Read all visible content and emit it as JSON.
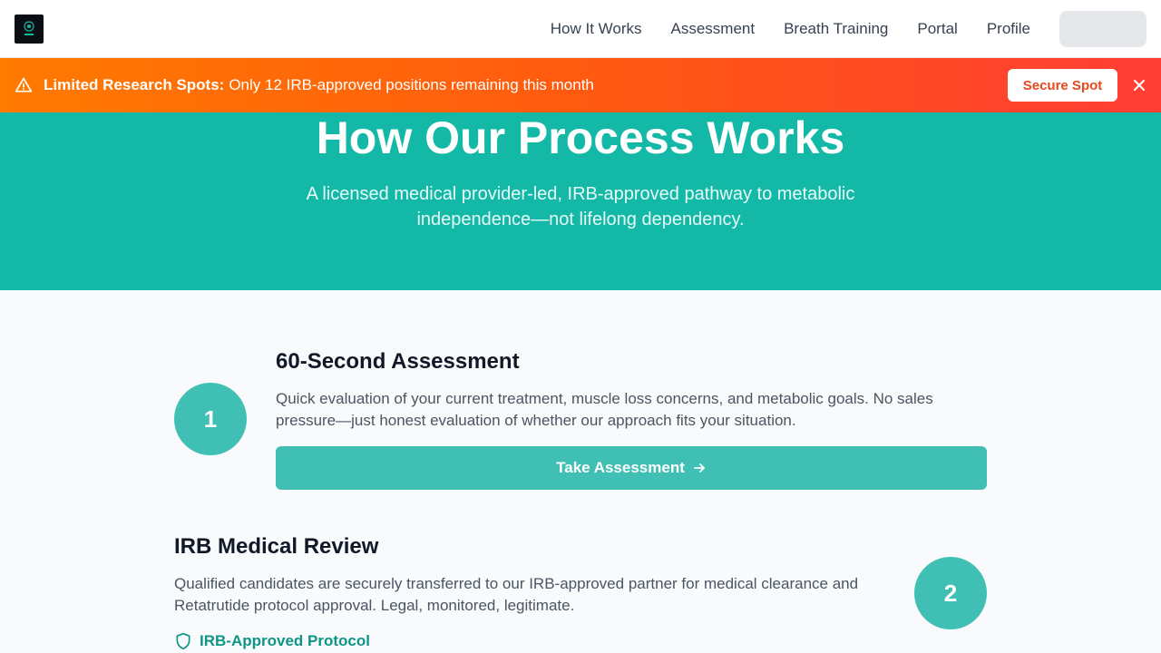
{
  "nav": {
    "links": [
      "How It Works",
      "Assessment",
      "Breath Training",
      "Portal",
      "Profile"
    ]
  },
  "banner": {
    "strong": "Limited Research Spots:",
    "text": "Only 12 IRB-approved positions remaining this month",
    "button": "Secure Spot",
    "icon": "warning-icon",
    "close_icon": "close-icon"
  },
  "hero": {
    "title": "How Our Process Works",
    "subtitle": "A licensed medical provider-led, IRB-approved pathway to metabolic independence—not lifelong dependency."
  },
  "steps": [
    {
      "number": "1",
      "title": "60-Second Assessment",
      "description": "Quick evaluation of your current treatment, muscle loss concerns, and metabolic goals. No sales pressure—just honest evaluation of whether our approach fits your situation.",
      "cta": "Take Assessment"
    },
    {
      "number": "2",
      "title": "IRB Medical Review",
      "description": "Qualified candidates are securely transferred to our IRB-approved partner for medical clearance and Retatrutide protocol approval. Legal, monitored, legitimate.",
      "tag": "IRB-Approved Protocol"
    }
  ],
  "colors": {
    "accent": "#14b8a6",
    "step": "#40bfb5",
    "banner_start": "#ff7a00",
    "banner_end": "#ff3d35"
  }
}
